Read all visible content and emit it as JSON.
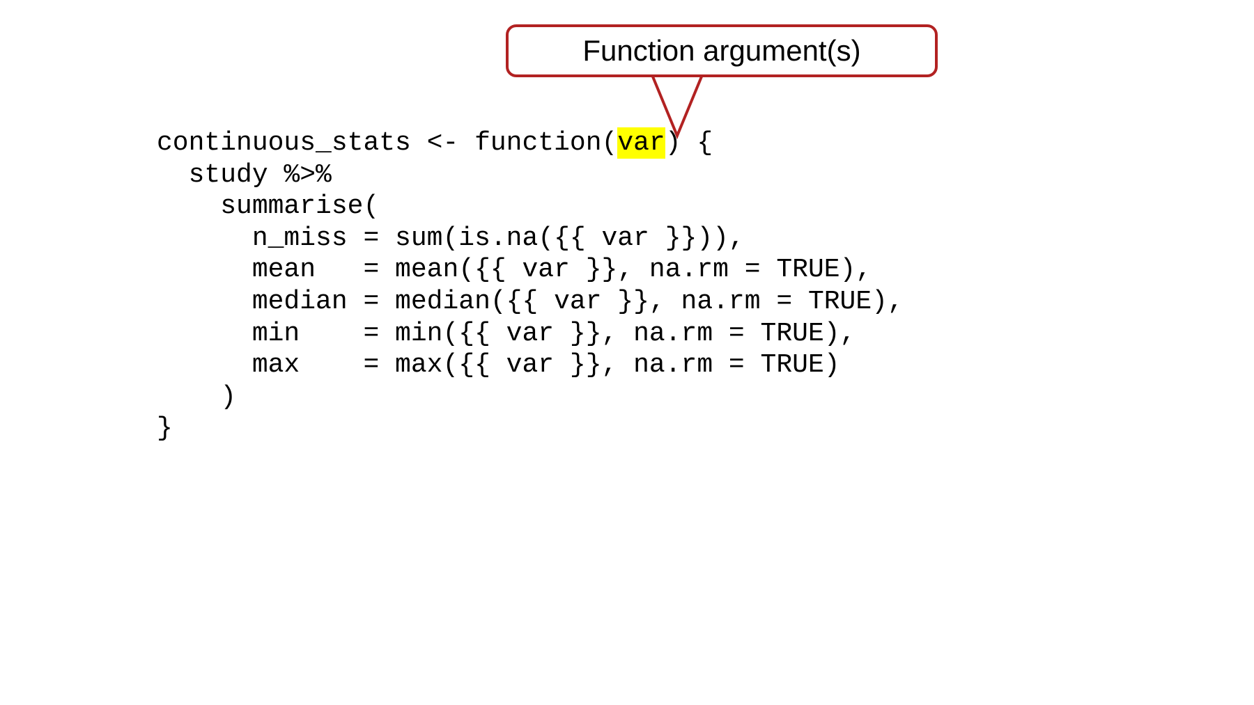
{
  "callout": {
    "label": "Function argument(s)"
  },
  "code": {
    "line1_pre": "continuous_stats <- function(",
    "line1_highlight": "var",
    "line1_post": ") {",
    "line2": "  study %>%",
    "line3": "    summarise(",
    "line4": "      n_miss = sum(is.na({{ var }})),",
    "line5": "      mean   = mean({{ var }}, na.rm = TRUE),",
    "line6": "      median = median({{ var }}, na.rm = TRUE),",
    "line7": "      min    = min({{ var }}, na.rm = TRUE),",
    "line8": "      max    = max({{ var }}, na.rm = TRUE)",
    "line9": "    )",
    "line10": "}"
  }
}
